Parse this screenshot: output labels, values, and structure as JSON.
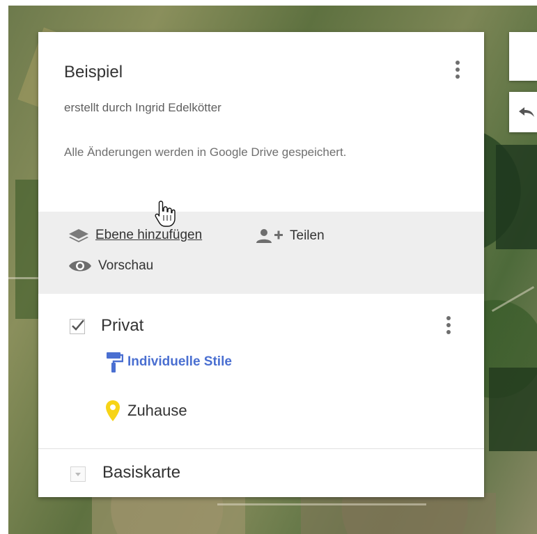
{
  "map": {
    "title": "Beispiel",
    "author": "erstellt durch Ingrid Edelkötter",
    "save_status": "Alle Änderungen werden in Google Drive gespeichert."
  },
  "toolbar": {
    "add_layer": "Ebene hinzufügen",
    "share": "Teilen",
    "preview": "Vorschau"
  },
  "layer": {
    "name": "Privat",
    "checked": true,
    "style_link": "Individuelle Stile",
    "places": [
      {
        "name": "Zuhause",
        "icon": "marker-icon",
        "color": "#f7d417"
      }
    ]
  },
  "basemap": {
    "label": "Basiskarte"
  },
  "colors": {
    "link_blue": "#4a6fd1",
    "toolbar_bg": "#eeeeee",
    "marker_yellow": "#f7d417"
  }
}
